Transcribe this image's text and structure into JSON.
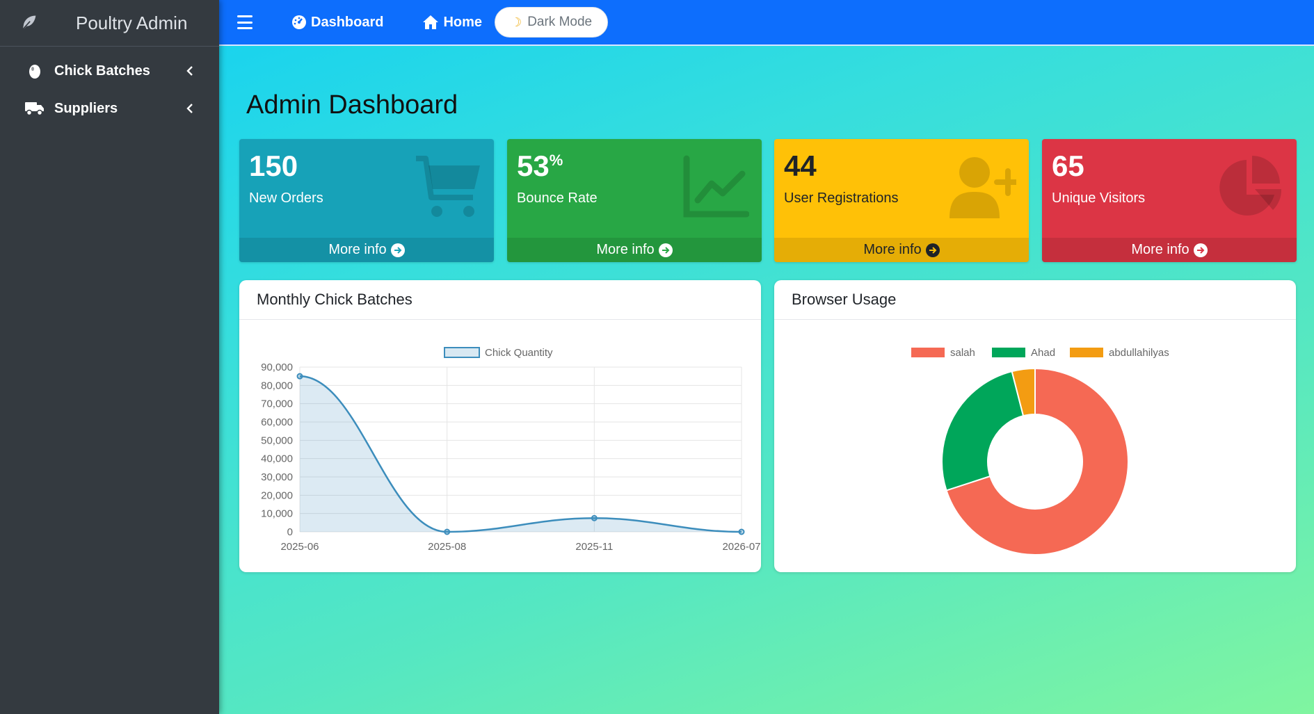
{
  "sidebar": {
    "brand": "Poultry Admin",
    "items": [
      {
        "label": "Chick Batches",
        "icon": "egg-icon"
      },
      {
        "label": "Suppliers",
        "icon": "truck-icon"
      }
    ]
  },
  "topbar": {
    "dashboard": "Dashboard",
    "home": "Home",
    "dark_mode": "Dark Mode"
  },
  "page": {
    "title": "Admin Dashboard"
  },
  "boxes": [
    {
      "value": "150",
      "label": "New Orders",
      "more": "More info",
      "color": "#17a2b8",
      "icon": "cart-icon"
    },
    {
      "value": "53",
      "suffix": "%",
      "label": "Bounce Rate",
      "more": "More info",
      "color": "#28a745",
      "icon": "chart-line-icon"
    },
    {
      "value": "44",
      "label": "User Registrations",
      "more": "More info",
      "color": "#ffc107",
      "icon": "user-plus-icon"
    },
    {
      "value": "65",
      "label": "Unique Visitors",
      "more": "More info",
      "color": "#dc3545",
      "icon": "pie-chart-icon"
    }
  ],
  "cards": {
    "line_title": "Monthly Chick Batches",
    "donut_title": "Browser Usage"
  },
  "chart_data": [
    {
      "type": "area",
      "title": "",
      "categories": [
        "2025-06",
        "2025-08",
        "2025-11",
        "2026-07"
      ],
      "series": [
        {
          "name": "Chick Quantity",
          "values": [
            85000,
            0,
            7500,
            0
          ],
          "color": "#3c8dbc"
        }
      ],
      "ylim": [
        0,
        90000
      ],
      "yticks": [
        "0",
        "10,000",
        "20,000",
        "30,000",
        "40,000",
        "50,000",
        "60,000",
        "70,000",
        "80,000",
        "90,000"
      ],
      "grid": true,
      "legend": "top"
    },
    {
      "type": "pie",
      "donut": true,
      "labels": [
        "salah",
        "Ahad",
        "abdullahilyas"
      ],
      "values": [
        70,
        26,
        4
      ],
      "colors": [
        "#f56954",
        "#00a65a",
        "#f39c12"
      ],
      "legend": "top"
    }
  ]
}
